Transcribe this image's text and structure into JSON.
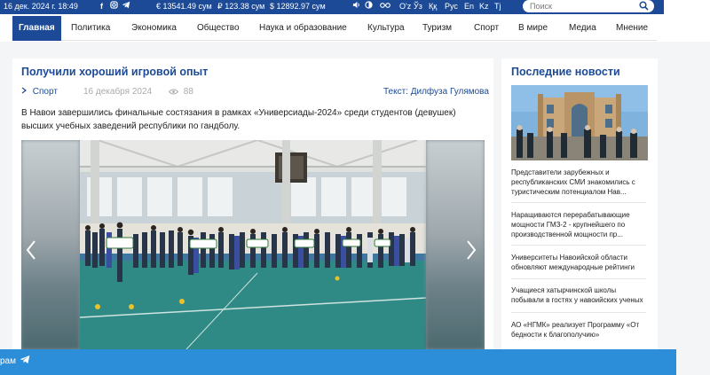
{
  "topbar": {
    "date": "16 дек. 2024 г. 18:49",
    "social": [
      "f",
      "instagram-icon",
      "telegram-icon"
    ],
    "rates": [
      "€ 13541.49 сум",
      "₽ 123.38 сум",
      "$ 12892.97 сум"
    ],
    "langs": [
      "O'z",
      "Ўз",
      "Ққ",
      "Рус",
      "En",
      "Kz",
      "Tj"
    ],
    "search_placeholder": "Поиск"
  },
  "nav": {
    "items": [
      "Главная",
      "Политика",
      "Экономика",
      "Общество",
      "Наука и образование",
      "Культура",
      "Туризм",
      "Спорт",
      "В мире",
      "Медиа",
      "Мнение"
    ]
  },
  "article": {
    "title": "Получили хороший игровой опыт",
    "category": "Спорт",
    "date": "16 декабря 2024",
    "views": "88",
    "author": "Текст: Дилфуза Гулямова",
    "lead": "В Навои завершились финальные состязания в рамках «Универсиады-2024» среди студентов (девушек) высших учебных заведений республики по гандболу."
  },
  "sidebar": {
    "title": "Последние новости",
    "news": [
      "Представители зарубежных и республиканских СМИ знакомились с туристическим потенциалом Нав...",
      "Наращиваются перерабатывающие мощности ГМЗ-2 - крупнейшего по производственной мощности пр...",
      "Университеты Навоийской области обновляют международные рейтинги",
      "Учащиеся хатырчинской школы побывали в гостях у навоийских ученых",
      "АО «НГМК» реализует Программу «От бедности к благополучию»"
    ]
  },
  "bottombar": {
    "text": "рам"
  },
  "colors": {
    "brand": "#1c4a96",
    "bottombar": "#2c8ed8"
  }
}
